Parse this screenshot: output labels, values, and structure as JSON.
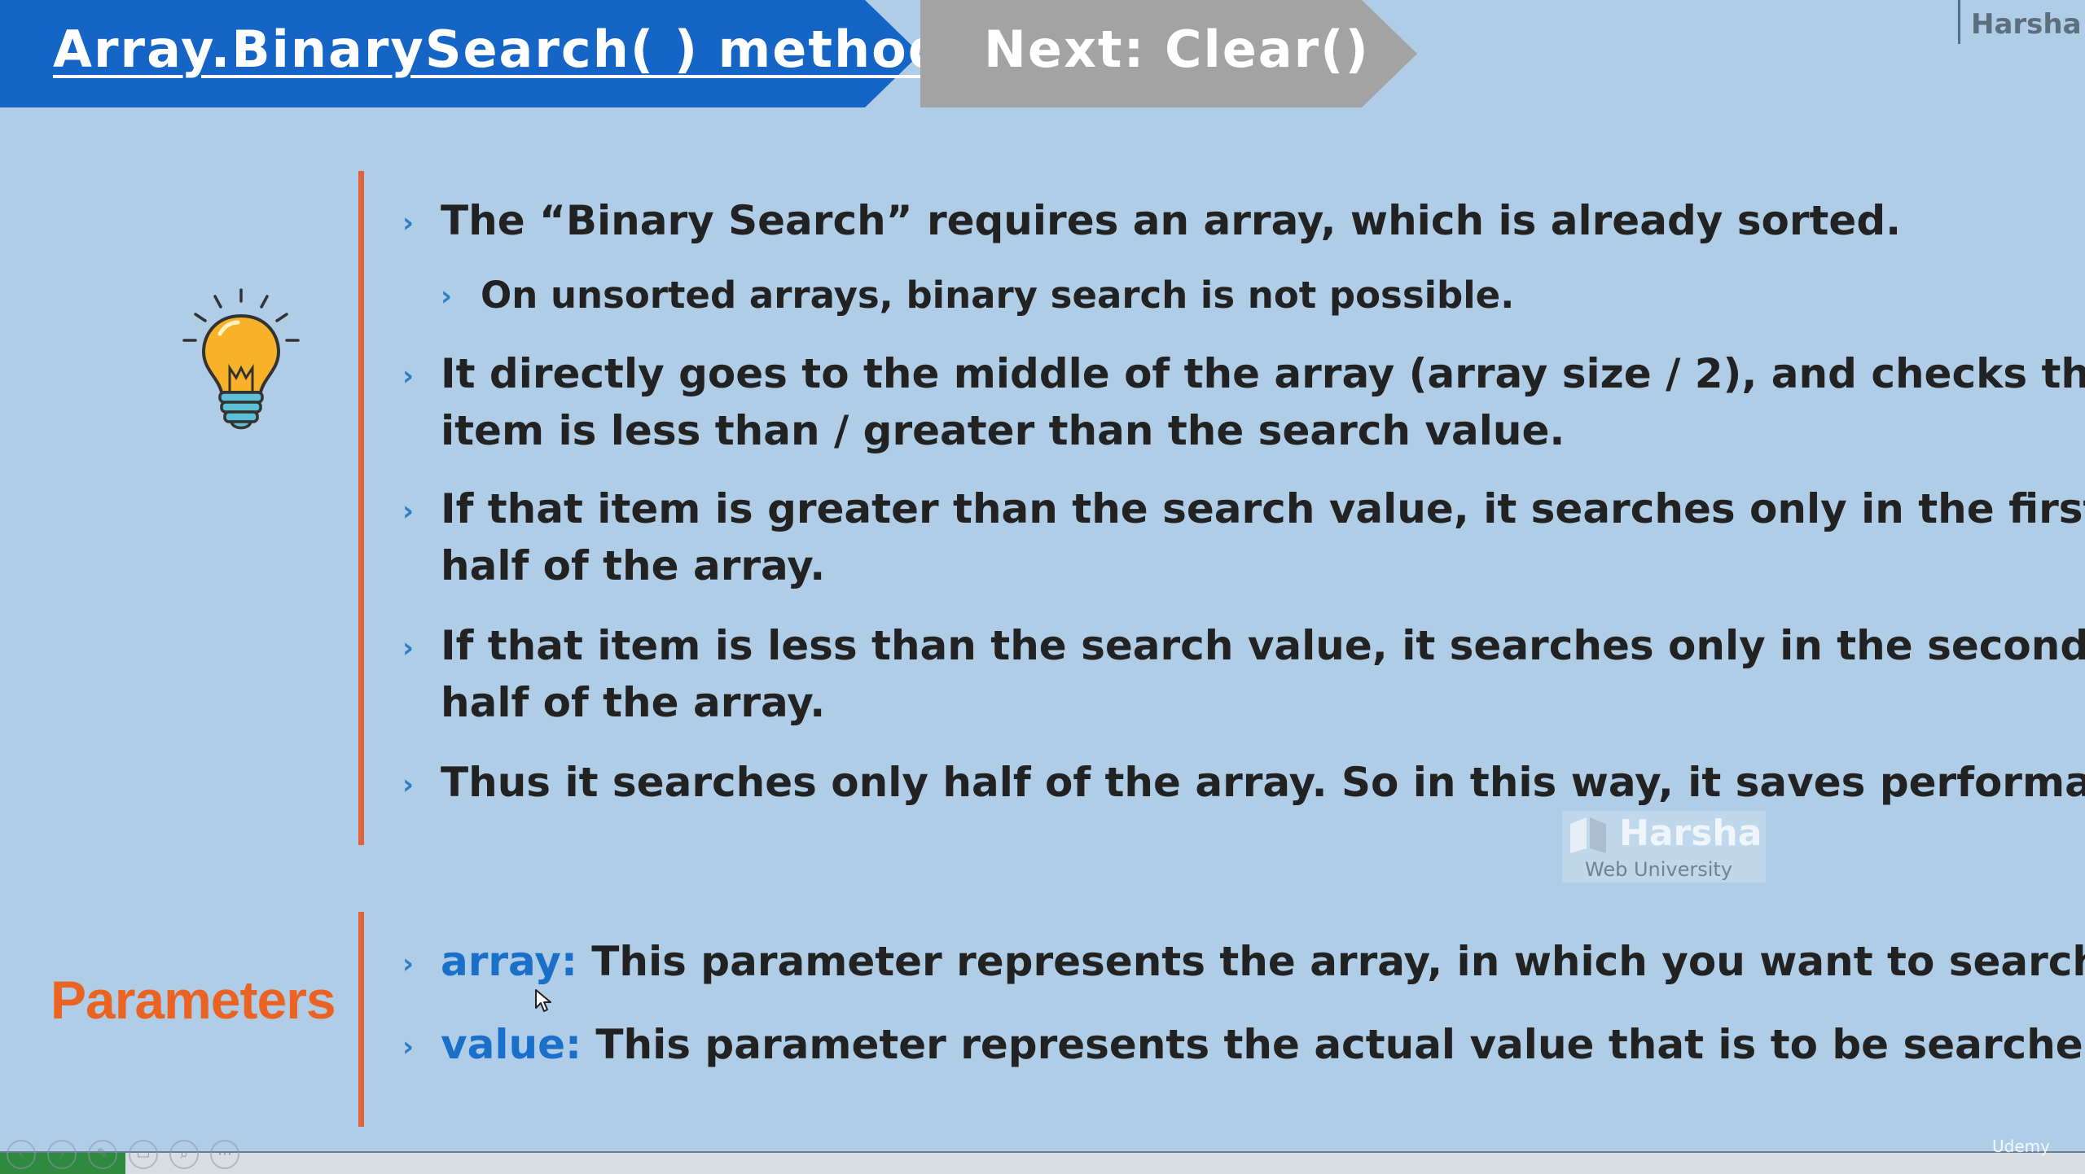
{
  "header": {
    "title": "Array.BinarySearch( ) method",
    "next_label": "Next: Clear()",
    "brand": "Harsha"
  },
  "content": {
    "bullets": [
      {
        "text": "The “Binary Search” requires an array, which is already sorted."
      },
      {
        "text": "On unsorted arrays, binary search is not possible."
      },
      {
        "line1": "It directly goes to the middle of the array (array size / 2), and checks that",
        "line2": "item is less than / greater than the search value."
      },
      {
        "line1": "If that item is greater than the search value, it searches only in the first",
        "line2": "half of the array."
      },
      {
        "line1": "If that item is less than the search value, it searches only in the second",
        "line2": "half of the array."
      },
      {
        "text": "Thus it searches only half of the array. So in this way, it saves performance"
      }
    ],
    "bullet_marker": "›"
  },
  "parameters": {
    "heading": "Parameters",
    "items": [
      {
        "name": "array:",
        "description": "This parameter represents the array, in which you want to search."
      },
      {
        "name": "value:",
        "description": "This parameter represents the actual value that is to be searched"
      }
    ]
  },
  "watermark": {
    "name": "Harsha",
    "subtitle": "Web University"
  },
  "player": {
    "brand": "Udemy",
    "icons": [
      "prev-icon",
      "next-icon",
      "pen-icon",
      "slides-icon",
      "zoom-icon",
      "more-icon"
    ]
  },
  "colors": {
    "title_bg": "#1565c7",
    "next_bg": "#a3a3a3",
    "accent_orange": "#e0643a",
    "param_blue": "#1a6fc9",
    "background": "#afcde6"
  }
}
